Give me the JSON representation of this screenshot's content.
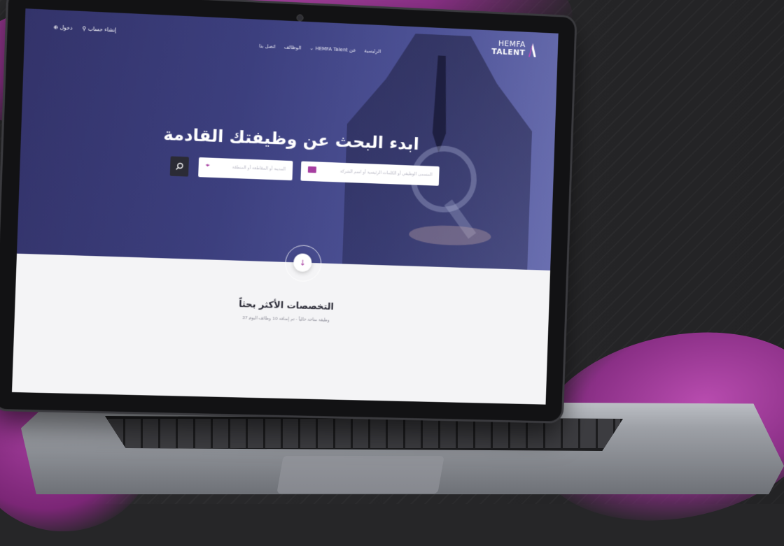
{
  "site": {
    "logo_line1": "HEMFA",
    "logo_line2": "TALENT",
    "nav": [
      "الرئيسية",
      "عن HEMFA Talent ⌄",
      "الوظائف",
      "اتصل بنا"
    ],
    "auth": {
      "register": "إنشاء حساب",
      "login": "دخول"
    },
    "hero": {
      "title": "ابدء البحث عن وظيفتك القادمة",
      "keyword_placeholder": "المسمى الوظيفي أو الكلمات الرئيسية أو اسم الشركة",
      "location_placeholder": "المدينة أو المقاطعة أو المنطقة"
    },
    "section": {
      "title": "التخصصات الأكثر بحثاً",
      "subtitle": "37 وظيفة متاحة حالياً - تم إضافة 10 وظائف اليوم"
    }
  },
  "icons": {
    "search": "search-icon",
    "location": "location-pin-icon",
    "keyword": "briefcase-icon",
    "down": "arrow-down-icon"
  },
  "colors": {
    "accent": "#a63ea0",
    "hero": "#3c3f7e"
  }
}
